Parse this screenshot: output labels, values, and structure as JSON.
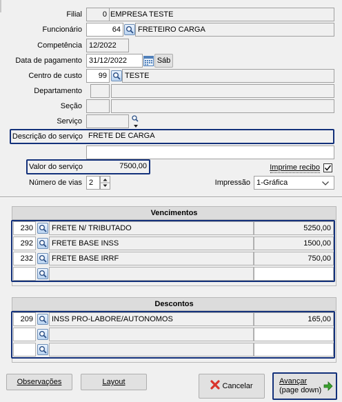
{
  "form": {
    "filial": {
      "label": "Filial",
      "code": "0",
      "name": "EMPRESA TESTE"
    },
    "funcionario": {
      "label": "Funcionário",
      "code": "64",
      "name": "FRETEIRO CARGA"
    },
    "competencia": {
      "label": "Competência",
      "value": "12/2022"
    },
    "data_pagamento": {
      "label": "Data de pagamento",
      "value": "31/12/2022",
      "weekday": "Sáb"
    },
    "centro_custo": {
      "label": "Centro de custo",
      "code": "99",
      "name": "TESTE"
    },
    "departamento": {
      "label": "Departamento"
    },
    "secao": {
      "label": "Seção"
    },
    "servico": {
      "label": "Serviço"
    },
    "descricao": {
      "label": "Descrição do serviço",
      "value": "FRETE DE CARGA",
      "value2": ""
    },
    "valor": {
      "label": "Valor do serviço",
      "value": "7500,00"
    },
    "imprime_recibo": {
      "label": "Imprime recibo",
      "checked": true
    },
    "numero_vias": {
      "label": "Número de vias",
      "value": "2"
    },
    "impressao": {
      "label": "Impressão",
      "selected": "1-Gráfica"
    }
  },
  "vencimentos": {
    "title": "Vencimentos",
    "rows": [
      {
        "code": "230",
        "desc": "FRETE N/ TRIBUTADO",
        "value": "5250,00"
      },
      {
        "code": "292",
        "desc": "FRETE BASE INSS",
        "value": "1500,00"
      },
      {
        "code": "232",
        "desc": "FRETE BASE IRRF",
        "value": "750,00"
      },
      {
        "code": "",
        "desc": "",
        "value": ""
      }
    ]
  },
  "descontos": {
    "title": "Descontos",
    "rows": [
      {
        "code": "209",
        "desc": "INSS PRO-LABORE/AUTONOMOS",
        "value": "165,00"
      },
      {
        "code": "",
        "desc": "",
        "value": ""
      },
      {
        "code": "",
        "desc": "",
        "value": ""
      }
    ]
  },
  "buttons": {
    "observacoes": "Observações",
    "layout": "Layout",
    "cancelar": "Cancelar",
    "avancar_line1": "Avançar",
    "avancar_line2": "(page down)"
  },
  "colors": {
    "highlight": "#12307a",
    "cancel_icon": "#d9342b",
    "advance_icon": "#3aa02e"
  },
  "icons": [
    "lookup-icon",
    "calendar-icon",
    "checkmark-icon",
    "spin-up-icon",
    "spin-down-icon",
    "dropdown-arrow-icon",
    "cancel-x-icon",
    "arrow-right-icon"
  ]
}
